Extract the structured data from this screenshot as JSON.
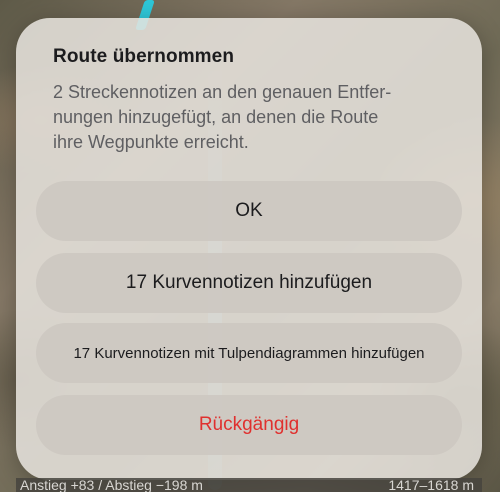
{
  "dialog": {
    "title": "Route übernommen",
    "message": "2 Streckennotizen an den genauen Entfer-\nnungen hinzugefügt, an denen die Route\nihre Wegpunkte erreicht.",
    "buttons": {
      "ok": "OK",
      "add_curve_notes": "17 Kurvennotizen hinzufügen",
      "add_curve_notes_tulip": "17 Kurvennotizen mit Tulpendiagrammen hinzufügen",
      "undo": "Rückgängig"
    }
  },
  "status_bar": {
    "ascent_descent": "Anstieg +83 / Abstieg −198 m",
    "elevation_range": "1417–1618 m"
  },
  "colors": {
    "destructive": "#e0302e",
    "route": "#2ec7d8"
  }
}
